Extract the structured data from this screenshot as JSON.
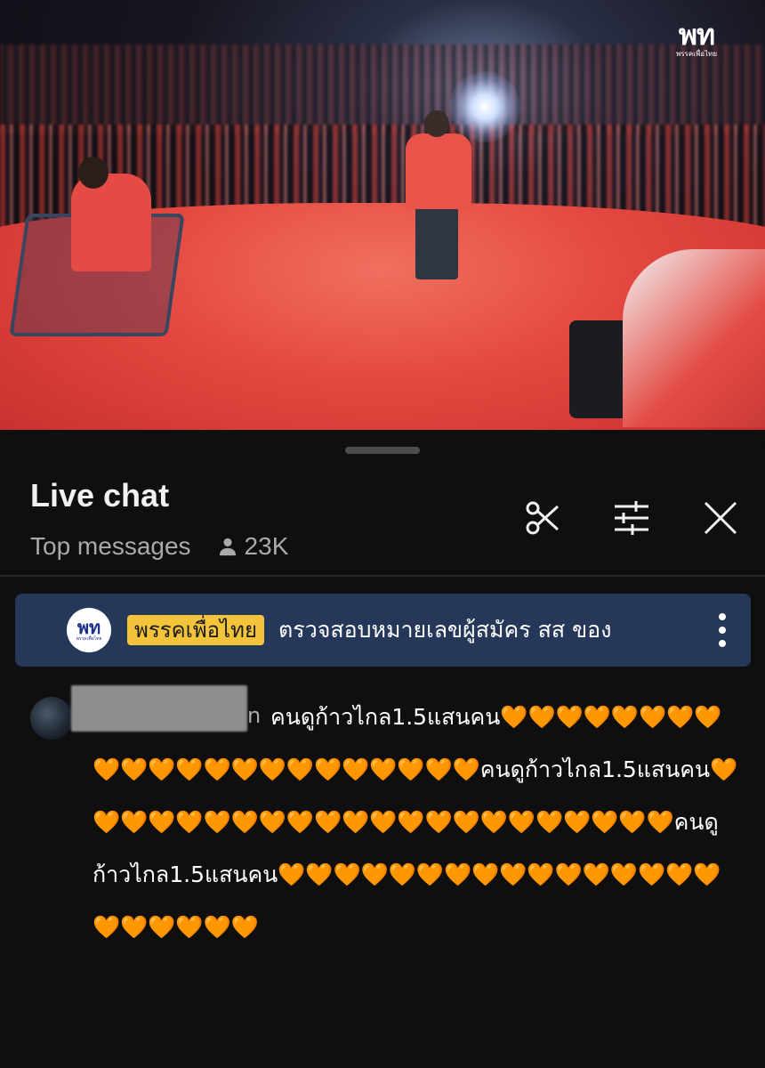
{
  "video": {
    "logo_mark": "พท",
    "logo_sub": "พรรคเพื่อไทย"
  },
  "live_chat": {
    "title": "Live chat",
    "filter": "Top messages",
    "viewer_count": "23K",
    "icons": [
      "scissors-icon",
      "sliders-icon",
      "close-icon"
    ]
  },
  "pinned": {
    "avatar_mark": "พท",
    "avatar_sub": "พรรคเพื่อไทย",
    "author": "พรรคเพื่อไทย",
    "text": "ตรวจสอบหมายเลขผู้สมัคร สส ของ"
  },
  "message": {
    "name_visible_suffix": "n",
    "text": "คนดูก้าวไกล1.5แสนคน🧡🧡🧡🧡🧡🧡🧡🧡🧡🧡🧡🧡🧡🧡🧡🧡🧡🧡🧡🧡🧡🧡คนดูก้าวไกล1.5แสนคน🧡🧡🧡🧡🧡🧡🧡🧡🧡🧡🧡🧡🧡🧡🧡🧡🧡🧡🧡🧡🧡🧡คนดูก้าวไกล1.5แสนคน🧡🧡🧡🧡🧡🧡🧡🧡🧡🧡🧡🧡🧡🧡🧡🧡🧡🧡🧡🧡🧡🧡"
  },
  "colors": {
    "pinned_bg": "#263859",
    "author_badge": "#f3c43a",
    "panel_bg": "#0f0f0f"
  }
}
